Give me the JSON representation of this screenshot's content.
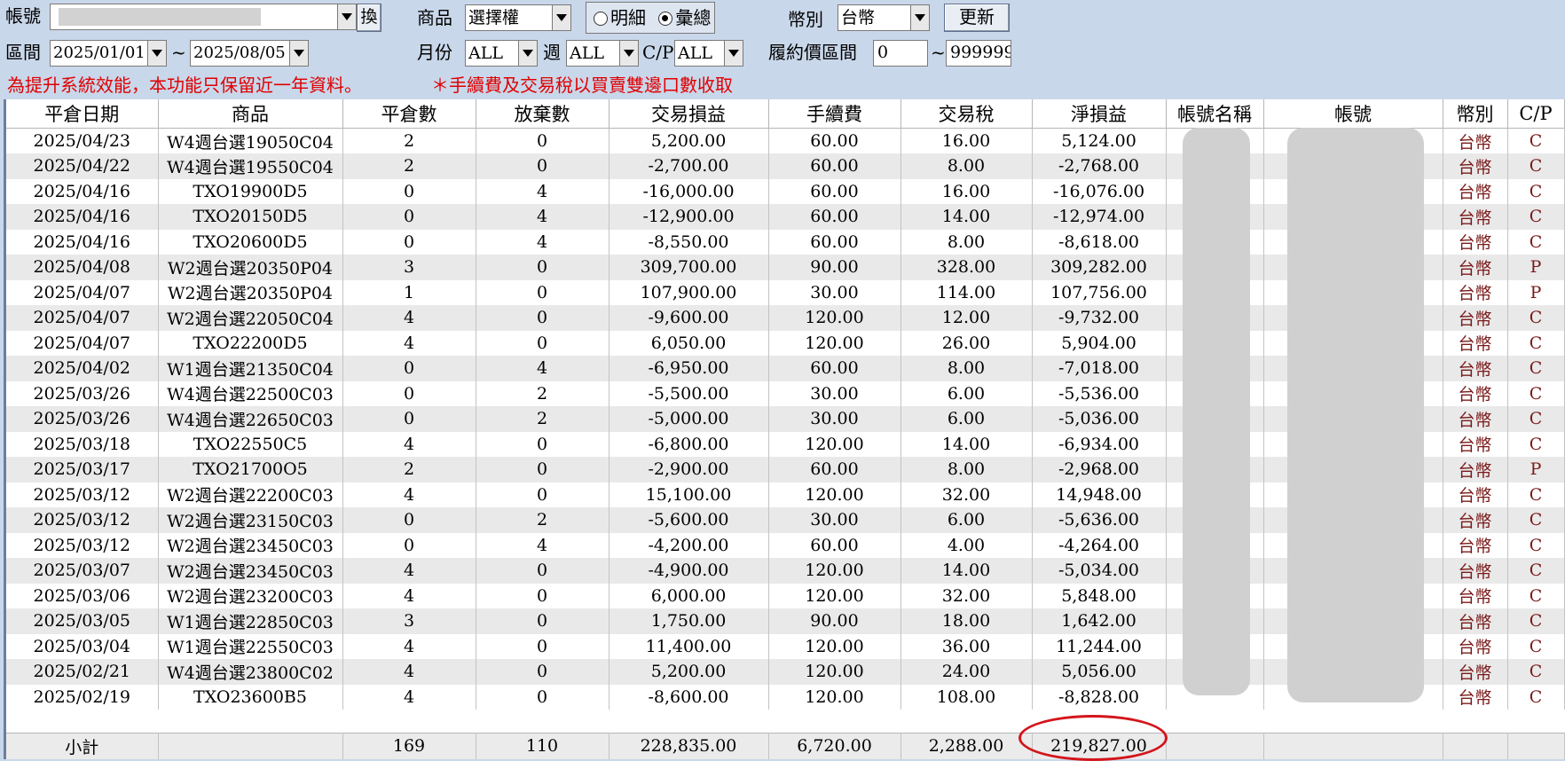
{
  "toolbar": {
    "account_label": "帳號",
    "swap_label": "換",
    "product_label": "商品",
    "product_value": "選擇權",
    "radio_detail": "明細",
    "radio_summary": "彙總",
    "currency_label": "幣別",
    "currency_value": "台幣",
    "refresh_label": "更新",
    "range_label": "區間",
    "date_from": "2025/01/01",
    "tilde": "~",
    "date_to": "2025/08/05",
    "month_label": "月份",
    "month_value": "ALL",
    "week_label": "週",
    "week_value": "ALL",
    "cp_label": "C/P",
    "cp_value": "ALL",
    "strike_label": "履約價區間",
    "strike_min": "0",
    "strike_max": "999999"
  },
  "notice": {
    "retention": "為提升系統效能，本功能只保留近一年資料。",
    "fees": "＊手續費及交易稅以買賣雙邊口數收取"
  },
  "columns": [
    "平倉日期",
    "商品",
    "平倉數",
    "放棄數",
    "交易損益",
    "手續費",
    "交易稅",
    "淨損益",
    "帳號名稱",
    "帳號",
    "幣別",
    "C/P"
  ],
  "rows": [
    [
      "2025/04/23",
      "W4週台選19050C04",
      "2",
      "0",
      "5,200.00",
      "60.00",
      "16.00",
      "5,124.00",
      "台幣",
      "C"
    ],
    [
      "2025/04/22",
      "W4週台選19550C04",
      "2",
      "0",
      "-2,700.00",
      "60.00",
      "8.00",
      "-2,768.00",
      "台幣",
      "C"
    ],
    [
      "2025/04/16",
      "TXO19900D5",
      "0",
      "4",
      "-16,000.00",
      "60.00",
      "16.00",
      "-16,076.00",
      "台幣",
      "C"
    ],
    [
      "2025/04/16",
      "TXO20150D5",
      "0",
      "4",
      "-12,900.00",
      "60.00",
      "14.00",
      "-12,974.00",
      "台幣",
      "C"
    ],
    [
      "2025/04/16",
      "TXO20600D5",
      "0",
      "4",
      "-8,550.00",
      "60.00",
      "8.00",
      "-8,618.00",
      "台幣",
      "C"
    ],
    [
      "2025/04/08",
      "W2週台選20350P04",
      "3",
      "0",
      "309,700.00",
      "90.00",
      "328.00",
      "309,282.00",
      "台幣",
      "P"
    ],
    [
      "2025/04/07",
      "W2週台選20350P04",
      "1",
      "0",
      "107,900.00",
      "30.00",
      "114.00",
      "107,756.00",
      "台幣",
      "P"
    ],
    [
      "2025/04/07",
      "W2週台選22050C04",
      "4",
      "0",
      "-9,600.00",
      "120.00",
      "12.00",
      "-9,732.00",
      "台幣",
      "C"
    ],
    [
      "2025/04/07",
      "TXO22200D5",
      "4",
      "0",
      "6,050.00",
      "120.00",
      "26.00",
      "5,904.00",
      "台幣",
      "C"
    ],
    [
      "2025/04/02",
      "W1週台選21350C04",
      "0",
      "4",
      "-6,950.00",
      "60.00",
      "8.00",
      "-7,018.00",
      "台幣",
      "C"
    ],
    [
      "2025/03/26",
      "W4週台選22500C03",
      "0",
      "2",
      "-5,500.00",
      "30.00",
      "6.00",
      "-5,536.00",
      "台幣",
      "C"
    ],
    [
      "2025/03/26",
      "W4週台選22650C03",
      "0",
      "2",
      "-5,000.00",
      "30.00",
      "6.00",
      "-5,036.00",
      "台幣",
      "C"
    ],
    [
      "2025/03/18",
      "TXO22550C5",
      "4",
      "0",
      "-6,800.00",
      "120.00",
      "14.00",
      "-6,934.00",
      "台幣",
      "C"
    ],
    [
      "2025/03/17",
      "TXO21700O5",
      "2",
      "0",
      "-2,900.00",
      "60.00",
      "8.00",
      "-2,968.00",
      "台幣",
      "P"
    ],
    [
      "2025/03/12",
      "W2週台選22200C03",
      "4",
      "0",
      "15,100.00",
      "120.00",
      "32.00",
      "14,948.00",
      "台幣",
      "C"
    ],
    [
      "2025/03/12",
      "W2週台選23150C03",
      "0",
      "2",
      "-5,600.00",
      "30.00",
      "6.00",
      "-5,636.00",
      "台幣",
      "C"
    ],
    [
      "2025/03/12",
      "W2週台選23450C03",
      "0",
      "4",
      "-4,200.00",
      "60.00",
      "4.00",
      "-4,264.00",
      "台幣",
      "C"
    ],
    [
      "2025/03/07",
      "W2週台選23450C03",
      "4",
      "0",
      "-4,900.00",
      "120.00",
      "14.00",
      "-5,034.00",
      "台幣",
      "C"
    ],
    [
      "2025/03/06",
      "W2週台選23200C03",
      "4",
      "0",
      "6,000.00",
      "120.00",
      "32.00",
      "5,848.00",
      "台幣",
      "C"
    ],
    [
      "2025/03/05",
      "W1週台選22850C03",
      "3",
      "0",
      "1,750.00",
      "90.00",
      "18.00",
      "1,642.00",
      "台幣",
      "C"
    ],
    [
      "2025/03/04",
      "W1週台選22550C03",
      "4",
      "0",
      "11,400.00",
      "120.00",
      "36.00",
      "11,244.00",
      "台幣",
      "C"
    ],
    [
      "2025/02/21",
      "W4週台選23800C02",
      "4",
      "0",
      "5,200.00",
      "120.00",
      "24.00",
      "5,056.00",
      "台幣",
      "C"
    ],
    [
      "2025/02/19",
      "TXO23600B5",
      "4",
      "0",
      "-8,600.00",
      "120.00",
      "108.00",
      "-8,828.00",
      "台幣",
      "C"
    ]
  ],
  "subtotal": {
    "label": "小計",
    "closed_qty": "169",
    "abandoned_qty": "110",
    "trade_pnl": "228,835.00",
    "fee": "6,720.00",
    "tax": "2,288.00",
    "net_pnl": "219,827.00"
  },
  "colors": {
    "notice": "#e00000",
    "highlight_circle": "#d4151b",
    "panel_bg": "#c9d7ea"
  }
}
